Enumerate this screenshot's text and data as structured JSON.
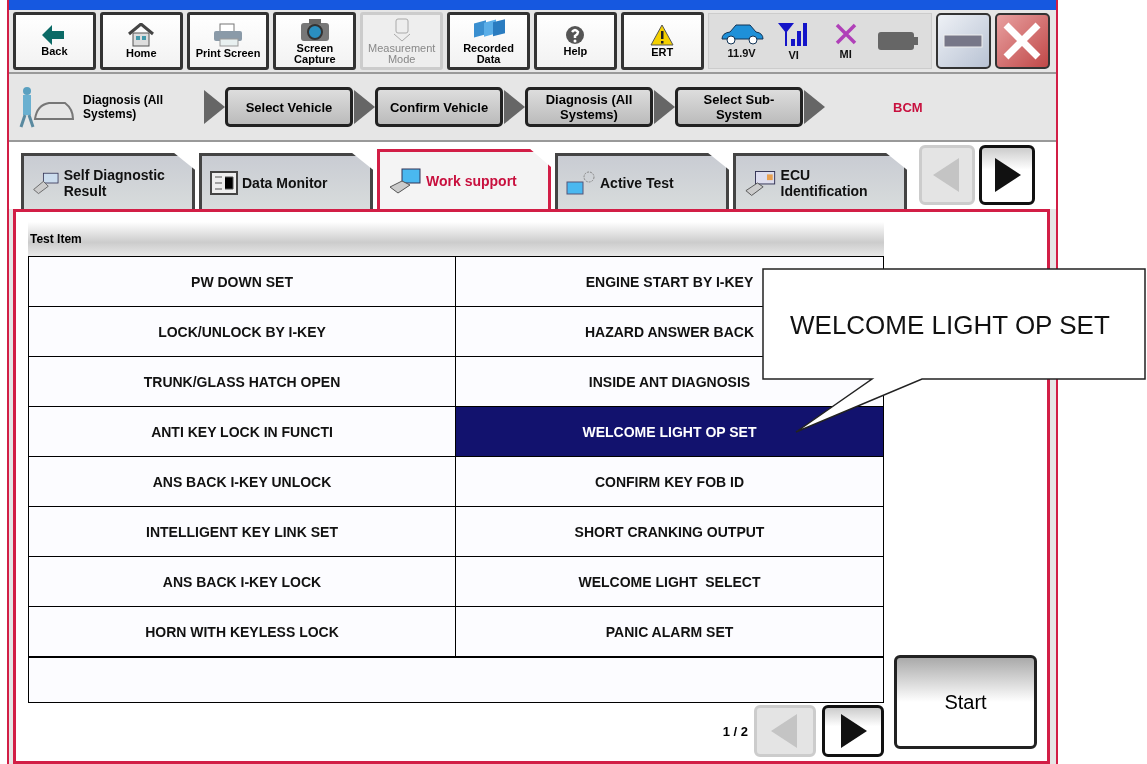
{
  "toolbar": {
    "buttons": [
      {
        "label": "Back",
        "kind": "back",
        "disabled": false
      },
      {
        "label": "Home",
        "kind": "home",
        "disabled": false
      },
      {
        "label": "Print Screen",
        "kind": "print",
        "disabled": false
      },
      {
        "label": "Screen Capture",
        "kind": "camera",
        "disabled": false
      },
      {
        "label": "Measurement Mode",
        "kind": "meter",
        "disabled": true
      },
      {
        "label": "Recorded Data",
        "kind": "folders",
        "disabled": false
      },
      {
        "label": "Help",
        "kind": "help",
        "disabled": false
      },
      {
        "label": "ERT",
        "kind": "warning",
        "disabled": false
      }
    ],
    "status": [
      {
        "kind": "car",
        "label": "11.9V"
      },
      {
        "kind": "signal",
        "label": "VI"
      },
      {
        "kind": "cross",
        "label": "MI"
      },
      {
        "kind": "battery"
      }
    ]
  },
  "breadcrumb": {
    "title": "Diagnosis (All Systems)",
    "steps": [
      "Select Vehicle",
      "Confirm Vehicle",
      "Diagnosis (All Systems)",
      "Select Sub-System"
    ],
    "current": "BCM"
  },
  "tabs": [
    {
      "label": "Self Diagnostic Result",
      "kind": "dtc",
      "selected": false
    },
    {
      "label": "Data Monitor",
      "kind": "monitor",
      "selected": false
    },
    {
      "label": "Work support",
      "kind": "work",
      "selected": true
    },
    {
      "label": "Active Test",
      "kind": "active",
      "selected": false
    },
    {
      "label": "ECU Identification",
      "kind": "ecu",
      "selected": false
    }
  ],
  "tab_nav": {
    "prev_disabled": true,
    "next_disabled": false
  },
  "table": {
    "header": "Test Item",
    "rows": [
      [
        {
          "text": "PW DOWN SET",
          "selected": false
        },
        {
          "text": "ENGINE START BY I-KEY",
          "selected": false
        }
      ],
      [
        {
          "text": "LOCK/UNLOCK BY I-KEY",
          "selected": false
        },
        {
          "text": "HAZARD ANSWER BACK",
          "selected": false
        }
      ],
      [
        {
          "text": "TRUNK/GLASS HATCH OPEN",
          "selected": false
        },
        {
          "text": "INSIDE ANT DIAGNOSIS",
          "selected": false
        }
      ],
      [
        {
          "text": "ANTI KEY LOCK IN FUNCTI",
          "selected": false
        },
        {
          "text": "WELCOME LIGHT OP SET",
          "selected": true
        }
      ],
      [
        {
          "text": "ANS BACK I-KEY UNLOCK",
          "selected": false
        },
        {
          "text": "CONFIRM KEY FOB ID",
          "selected": false
        }
      ],
      [
        {
          "text": "INTELLIGENT KEY LINK SET",
          "selected": false
        },
        {
          "text": "SHORT CRANKING OUTPUT",
          "selected": false
        }
      ],
      [
        {
          "text": "ANS BACK I-KEY LOCK",
          "selected": false
        },
        {
          "text": "WELCOME LIGHT  SELECT",
          "selected": false
        }
      ],
      [
        {
          "text": "HORN WITH KEYLESS LOCK",
          "selected": false
        },
        {
          "text": "PANIC ALARM SET",
          "selected": false
        }
      ]
    ]
  },
  "pager": {
    "text": "1 / 2",
    "prev_disabled": true,
    "next_disabled": false
  },
  "start_button": "Start",
  "callout": "WELCOME LIGHT OP SET"
}
